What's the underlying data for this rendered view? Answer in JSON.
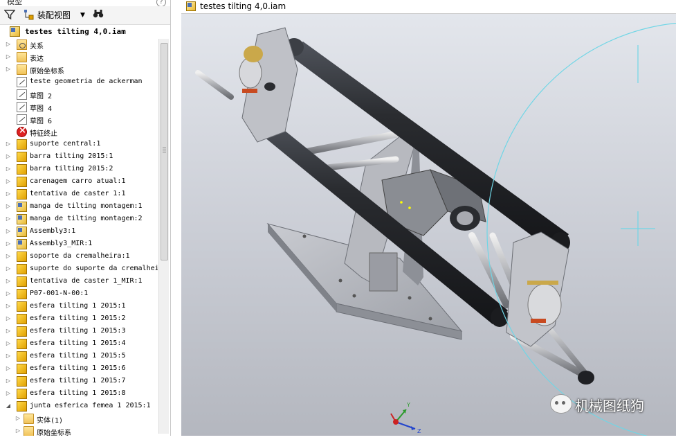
{
  "browser": {
    "panel_title": "模型",
    "view_label": "装配视图",
    "root": "testes tilting 4,0.iam",
    "items": [
      {
        "label": "关系",
        "icon": "relations-folder-icon",
        "type": "rel",
        "expand": "▷"
      },
      {
        "label": "表达",
        "icon": "representations-folder-icon",
        "type": "folder",
        "expand": "▷"
      },
      {
        "label": "原始坐标系",
        "icon": "origin-folder-icon",
        "type": "folder",
        "expand": "▷"
      },
      {
        "label": "teste geometria de ackerman",
        "icon": "sketch-icon",
        "type": "sketch",
        "expand": ""
      },
      {
        "label": "草图 2",
        "icon": "sketch-icon",
        "type": "sketch",
        "expand": ""
      },
      {
        "label": "草图 4",
        "icon": "sketch-icon",
        "type": "sketch",
        "expand": ""
      },
      {
        "label": "草图 6",
        "icon": "sketch-icon",
        "type": "sketch",
        "expand": ""
      },
      {
        "label": "特征终止",
        "icon": "end-of-features-icon",
        "type": "stop",
        "expand": ""
      },
      {
        "label": "suporte central:1",
        "icon": "part-icon",
        "type": "partico",
        "expand": "▷"
      },
      {
        "label": "barra tilting 2015:1",
        "icon": "part-icon",
        "type": "partico",
        "expand": "▷"
      },
      {
        "label": "barra tilting 2015:2",
        "icon": "part-icon",
        "type": "partico",
        "expand": "▷"
      },
      {
        "label": "carenagem carro atual:1",
        "icon": "part-icon",
        "type": "partico",
        "expand": "▷"
      },
      {
        "label": "tentativa de caster 1:1",
        "icon": "part-icon",
        "type": "partico",
        "expand": "▷"
      },
      {
        "label": "manga de tilting montagem:1",
        "icon": "subassembly-icon",
        "type": "asmico",
        "expand": "▷"
      },
      {
        "label": "manga de tilting montagem:2",
        "icon": "subassembly-icon",
        "type": "asmico",
        "expand": "▷"
      },
      {
        "label": "Assembly3:1",
        "icon": "subassembly-icon",
        "type": "asmico",
        "expand": "▷"
      },
      {
        "label": "Assembly3_MIR:1",
        "icon": "subassembly-icon",
        "type": "asmico",
        "expand": "▷"
      },
      {
        "label": "soporte da cremalheira:1",
        "icon": "part-icon",
        "type": "partico",
        "expand": "▷"
      },
      {
        "label": "suporte do suporte da cremalhei",
        "icon": "part-icon",
        "type": "partico",
        "expand": "▷"
      },
      {
        "label": "tentativa de caster 1_MIR:1",
        "icon": "part-icon",
        "type": "partico",
        "expand": "▷"
      },
      {
        "label": "P07-001-N-00:1",
        "icon": "part-icon",
        "type": "partico",
        "expand": "▷"
      },
      {
        "label": "esfera tilting 1 2015:1",
        "icon": "part-icon",
        "type": "partico",
        "expand": "▷"
      },
      {
        "label": "esfera tilting 1 2015:2",
        "icon": "part-icon",
        "type": "partico",
        "expand": "▷"
      },
      {
        "label": "esfera tilting 1 2015:3",
        "icon": "part-icon",
        "type": "partico",
        "expand": "▷"
      },
      {
        "label": "esfera tilting 1 2015:4",
        "icon": "part-icon",
        "type": "partico",
        "expand": "▷"
      },
      {
        "label": "esfera tilting 1 2015:5",
        "icon": "part-icon",
        "type": "partico",
        "expand": "▷"
      },
      {
        "label": "esfera tilting 1 2015:6",
        "icon": "part-icon",
        "type": "partico",
        "expand": "▷"
      },
      {
        "label": "esfera tilting 1 2015:7",
        "icon": "part-icon",
        "type": "partico",
        "expand": "▷"
      },
      {
        "label": "esfera tilting 1 2015:8",
        "icon": "part-icon",
        "type": "partico",
        "expand": "▷"
      },
      {
        "label": "junta esferica femea 1 2015:1",
        "icon": "part-icon",
        "type": "partico",
        "expand": "◢"
      },
      {
        "label": "实体(1)",
        "icon": "solid-bodies-icon",
        "type": "folder",
        "expand": "▷",
        "child": true
      },
      {
        "label": "原始坐标系",
        "icon": "origin-folder-icon",
        "type": "folder",
        "expand": "▷",
        "child": true
      }
    ]
  },
  "viewport": {
    "doc_title": "testes tilting 4,0.iam",
    "watermark": "机械图纸狗"
  },
  "colors": {
    "bg_top": "#e3e6ec",
    "bg_bottom": "#b4b7bf",
    "tube": "#2a2c30",
    "plate": "#b5b7bd",
    "circle": "#6fd6e6"
  }
}
